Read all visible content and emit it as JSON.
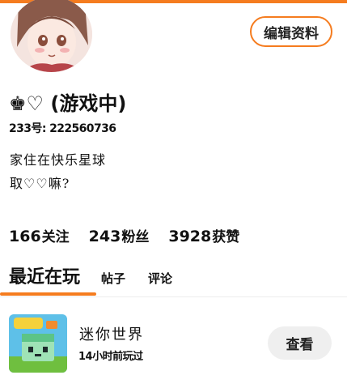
{
  "colors": {
    "accent": "#f57c1f",
    "button_bg": "#efefef"
  },
  "profile": {
    "avatar_icon": "avatar-image",
    "edit_label": "编辑资料",
    "username": "♚♡ (游戏中)",
    "uid": "233号: 222560736",
    "bio_line1": "家住在快乐星球",
    "bio_line2": "取♡♡嘛?"
  },
  "stats": [
    {
      "value": "166",
      "label": "关注"
    },
    {
      "value": "243",
      "label": "粉丝"
    },
    {
      "value": "3928",
      "label": "获赞"
    }
  ],
  "tabs": [
    {
      "label": "最近在玩"
    },
    {
      "label": "帖子"
    },
    {
      "label": "评论"
    }
  ],
  "game": {
    "icon": "mini-world-game-icon",
    "name": "迷你世界",
    "played": "14小时前玩过",
    "view_label": "查看"
  }
}
